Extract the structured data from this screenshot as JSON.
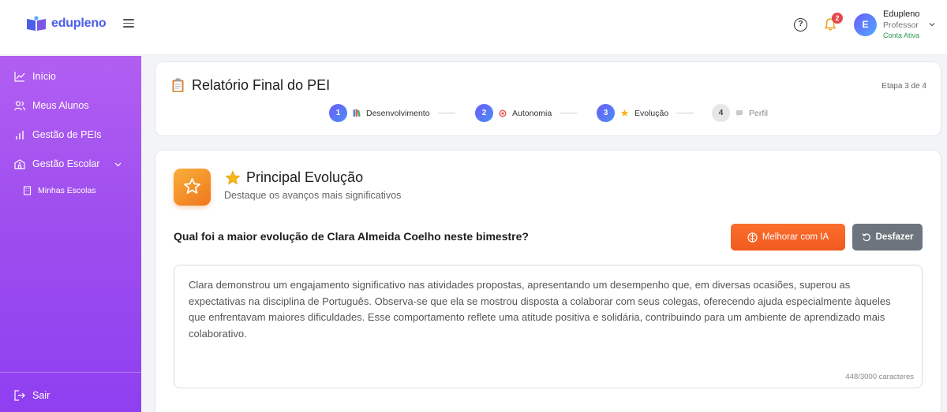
{
  "app": {
    "logo_text": "edupleno",
    "brand_color": "#4a5ee6"
  },
  "header": {
    "notification_count": "2",
    "avatar_initial": "E",
    "user_name": "Edupleno",
    "user_role": "Professor",
    "user_status": "Conta Ativa",
    "help_symbol": "?"
  },
  "sidebar": {
    "items": [
      {
        "label": "Início",
        "icon": "chart-line-icon"
      },
      {
        "label": "Meus Alunos",
        "icon": "users-icon"
      },
      {
        "label": "Gestão de PEIs",
        "icon": "bar-chart-icon"
      },
      {
        "label": "Gestão Escolar",
        "icon": "school-icon"
      }
    ],
    "sub_item": {
      "label": "Minhas Escolas",
      "icon": "building-icon"
    },
    "logout_label": "Sair",
    "gradient_colors": [
      "#b15ef2",
      "#8f3ff0"
    ]
  },
  "report": {
    "title": "Relatório Final do PEI",
    "step_count": "Etapa 3 de 4",
    "steps": [
      {
        "num": "1",
        "label": "Desenvolvimento",
        "icon": "books-icon",
        "state": "done"
      },
      {
        "num": "2",
        "label": "Autonomia",
        "icon": "target-icon",
        "state": "done"
      },
      {
        "num": "3",
        "label": "Evolução",
        "icon": "star-icon",
        "state": "current"
      },
      {
        "num": "4",
        "label": "Perfil",
        "icon": "speech-bubble-icon",
        "state": "pending"
      }
    ]
  },
  "section": {
    "title": "Principal Evolução",
    "subtitle": "Destaque os avanços mais significativos",
    "question": "Qual foi a maior evolução de Clara Almeida Coelho neste bimestre?",
    "ai_button": "Melhorar com IA",
    "undo_button": "Desfazer",
    "answer": "Clara demonstrou um engajamento significativo nas atividades propostas, apresentando um desempenho que, em diversas ocasiões, superou as expectativas na disciplina de Português. Observa-se que ela se mostrou disposta a colaborar com seus colegas, oferecendo ajuda especialmente àqueles que enfrentavam maiores dificuldades. Esse comportamento reflete uma atitude positiva e solidária, contribuindo para um ambiente de aprendizado mais colaborativo.",
    "char_count": "448/3000 caracteres",
    "accent_color": "#f25a1f"
  }
}
